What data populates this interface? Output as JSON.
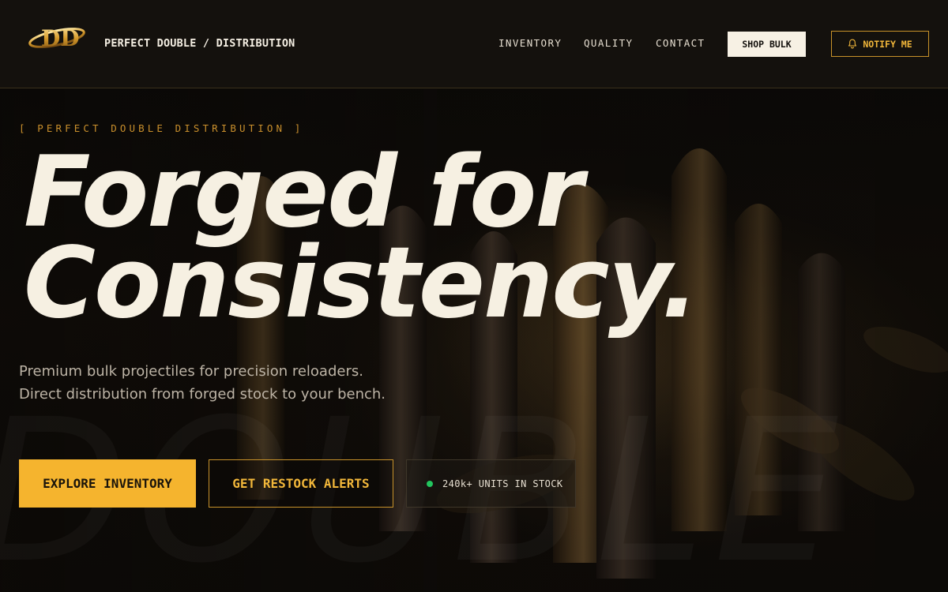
{
  "header": {
    "brand": "PERFECT DOUBLE / DISTRIBUTION",
    "nav": [
      {
        "label": "INVENTORY"
      },
      {
        "label": "QUALITY"
      },
      {
        "label": "CONTACT"
      }
    ],
    "shop_button": "SHOP BULK",
    "notify_button": "NOTIFY ME"
  },
  "hero": {
    "eyebrow": "[ PERFECT DOUBLE DISTRIBUTION ]",
    "headline_line1": "Forged for",
    "headline_line2": "Consistency.",
    "subtitle": "Premium bulk projectiles for precision reloaders. Direct distribution from forged stock to your bench.",
    "explore_button": "EXPLORE INVENTORY",
    "alerts_button": "GET RESTOCK ALERTS",
    "stock_status": "240k+ UNITS IN STOCK",
    "watermark": "DOUBLE"
  },
  "colors": {
    "accent": "#f5b42e",
    "accent_border": "#c8922a",
    "background": "#0c0a08",
    "header_bg": "#14110d",
    "text": "#f6f0e2",
    "status_green": "#22c55e"
  },
  "icons": {
    "logo": "pd-monogram-logo",
    "notify": "bell-icon",
    "status": "status-dot-icon"
  }
}
